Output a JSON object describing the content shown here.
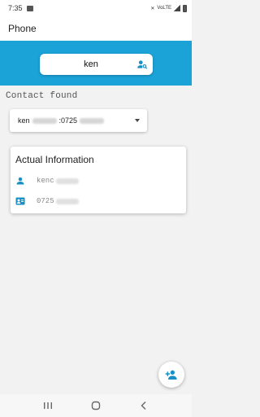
{
  "status_bar": {
    "time": "7:35",
    "network_label": "VoLTE"
  },
  "app_bar": {
    "title": "Phone"
  },
  "search": {
    "value": "ken",
    "placeholder": ""
  },
  "contact_found_label": "Contact found",
  "dropdown": {
    "selected_prefix": "ken",
    "selected_number": ":0725"
  },
  "card": {
    "title": "Actual Information",
    "name_value": "kenc",
    "phone_value": "0725"
  },
  "colors": {
    "accent": "#1ba3d8",
    "icon": "#1a8fc6",
    "background": "#f2f2f2"
  },
  "icons": {
    "search": "person-search-icon",
    "name": "person-icon",
    "phone": "contact-card-icon",
    "fab": "add-person-icon"
  }
}
